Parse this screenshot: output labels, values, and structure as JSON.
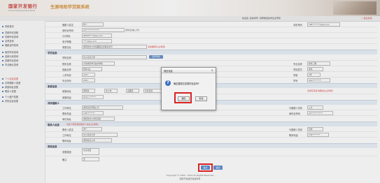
{
  "header": {
    "logo_zh": "国家开发银行",
    "logo_en": "China Development Bank",
    "system_title": "生源地助学贷款系统"
  },
  "topnav": {
    "welcome": "欢迎您, 您的学号: 请尊重您的学生证号码",
    "logout": "> 退出系统"
  },
  "sidebar": {
    "items": [
      {
        "label": "系统首页",
        "style": "normal"
      },
      {
        "label": "贷款申请流程",
        "style": "normal"
      },
      {
        "label": "贷款申请查询",
        "style": "normal"
      },
      {
        "label": "合同查询",
        "style": "normal"
      },
      {
        "label": "借款合同查询",
        "style": "normal"
      },
      {
        "label": "续贷申请查询",
        "style": "normal"
      },
      {
        "label": "还款计划查询",
        "style": "normal"
      },
      {
        "label": "变更申请查询",
        "style": "normal"
      },
      {
        "label": "毕业确认查询",
        "style": "normal"
      },
      {
        "label": "个人信息变更",
        "style": "red"
      },
      {
        "label": "共同借款人变更",
        "style": "normal"
      },
      {
        "label": "家庭地址变更",
        "style": "normal"
      },
      {
        "label": "联系人变更",
        "style": "normal"
      },
      {
        "label": "个人账户变更",
        "style": "normal"
      },
      {
        "label": "学历信息变更",
        "style": "normal"
      }
    ]
  },
  "form": {
    "personal": {
      "name_label": "借款人姓名",
      "name_value": "张**",
      "phone_label": "手机号码",
      "phone_value": "189********@qq.com",
      "id_label": "身份证号码",
      "id_value": "43**************",
      "id_type_value": "身份证(第二代)",
      "qq_label": "QQ号码",
      "qq_value": "98765****@qq.com",
      "email_label": "电子邮箱",
      "email_value": "****@qq.com",
      "addr_label": "家庭住址",
      "addr_value": "湖南省长沙市岳麓区某某路某某号",
      "addr_hint": "请准确填写(必填项)"
    },
    "school": {
      "section": "学历信息",
      "school_label": "学校名称",
      "school_value": "长沙某某大学",
      "school_btn": "选择学校",
      "college_label": "院系名称",
      "college_value": "计算机科学与技术学院",
      "major_label": "专业名称",
      "major_value": "软件工程",
      "class_label": "班级名称",
      "class_value": "软件1班",
      "edu_label": "学历层次",
      "edu_value": "本科",
      "years_label": "学制",
      "years_value": "4年",
      "enroll_label": "入学年份",
      "enroll_value": "2017",
      "grad_label": "毕业年份",
      "grad_value": "2021",
      "studentno_label": "学号",
      "studentno_value": "2017********"
    },
    "family": {
      "section": "家庭信息",
      "addr_label": "家庭地址",
      "province_value": "湖南省",
      "city_value": "长沙市",
      "county_value": "岳麓区",
      "detail_value": "某某街道",
      "hint": "请填写家庭详细地址(必填项)",
      "phone_label": "家庭电话",
      "phone_value": "0731-*******"
    },
    "coborrower": {
      "section": "共同借款人",
      "company_label": "工作单位",
      "company_value": "湖南某某有限公司",
      "relation_label": "与借款人关系",
      "relation_value": "父亲",
      "phone_label": "联系电话",
      "phone_value": "138********",
      "id_label": "身份证号码",
      "id_value": "43************",
      "addr_label": "单位地址",
      "addr_value": "湖南省长沙市某某区"
    },
    "contact": {
      "section": "联系人信息",
      "note": "请至少填写两位联系人信息(必填项)",
      "name_label": "联系人姓名",
      "name_value": "李**",
      "relation_label": "与借款人关系",
      "relation_value": "同学",
      "company_label": "工作单位",
      "company_value": "长沙某某大学",
      "phone_label": "联系电话",
      "phone_value": "139********",
      "addr_label": "联系地址",
      "addr_value": "湖南省长沙市"
    },
    "other": {
      "section": "其他信息",
      "remark_label": "备注",
      "remark_value": "无",
      "change_label": "变更原因",
      "change_value": "信息变更"
    }
  },
  "dialog": {
    "title": "网页消息",
    "message": "确定要提交变更的信息吗?",
    "ok_label": "确定",
    "cancel_label": "取消"
  },
  "actions": {
    "submit_label": "提交",
    "back_label": "返回"
  },
  "footer": {
    "line1": "Copyright © 2004 - 2014 All Rights Reserved",
    "line2": "国家开发银行版权所有"
  }
}
